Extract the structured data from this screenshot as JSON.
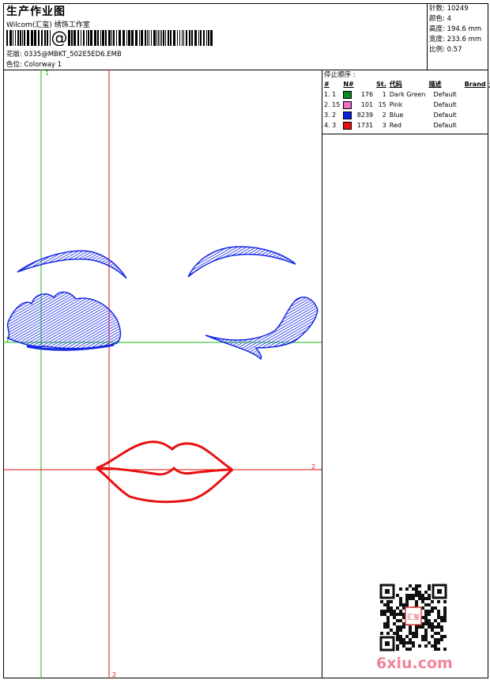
{
  "header": {
    "title": "生产作业图",
    "company": "Wilcom(汇玺) 绣饰工作室",
    "barcode_glyph": "@",
    "design_file": "花版:  0335@MBKT_502E5ED6.EMB",
    "colorway": "色位:  Colorway 1"
  },
  "stats": {
    "stitches": "针数:  10249",
    "colors": "颜色:  4",
    "height": "高度:  194.6 mm",
    "width": "宽度:  233.6 mm",
    "scale": "比例:  0.57"
  },
  "stop_sequence": {
    "title": "停止顺序 :",
    "columns": [
      "#",
      "N#",
      "St.",
      "代码",
      "描述",
      "Brand",
      "元素"
    ],
    "rows": [
      {
        "idx": "1. 1",
        "color": "#0a8a1e",
        "stitches": "176",
        "code": "1",
        "desc": "Dark Green",
        "brand": "Default"
      },
      {
        "idx": "2. 15",
        "color": "#f06ec8",
        "stitches": "101",
        "code": "15",
        "desc": "Pink",
        "brand": "Default"
      },
      {
        "idx": "3. 2",
        "color": "#1020e0",
        "stitches": "8239",
        "code": "2",
        "desc": "Blue",
        "brand": "Default"
      },
      {
        "idx": "4. 3",
        "color": "#e81010",
        "stitches": "1731",
        "code": "3",
        "desc": "Red",
        "brand": "Default"
      }
    ]
  },
  "guides": {
    "v_green_label": "1",
    "h_green_label": "1",
    "h_red_label": "2",
    "v_red_label": "2",
    "green": "#10c010",
    "red": "#e01010"
  },
  "watermark": "6xiu.com",
  "stamp_text": "汇玺"
}
